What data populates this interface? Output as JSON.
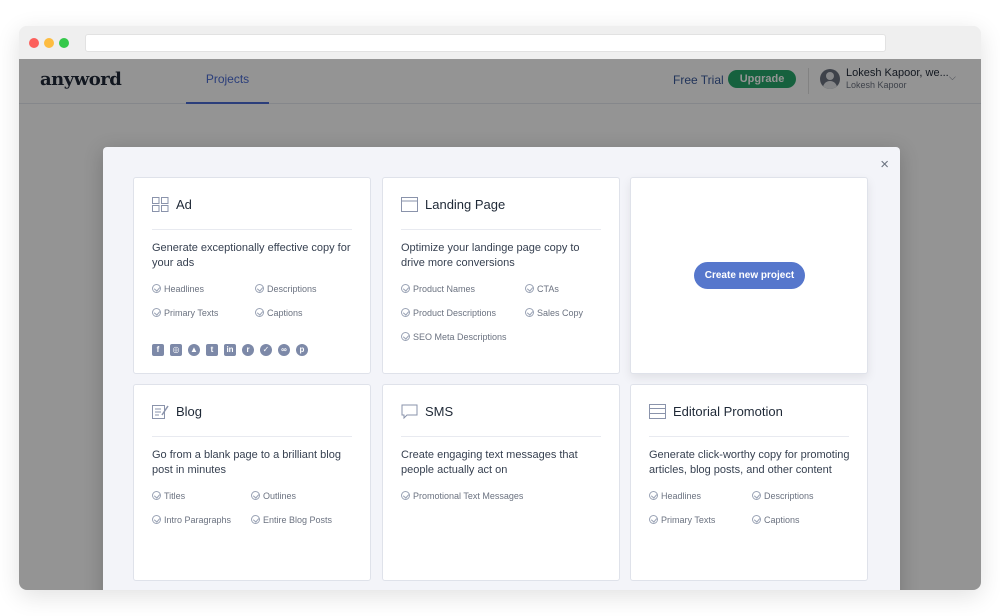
{
  "app": {
    "logo": "anyword",
    "nav_tab": "Projects",
    "free_trial": "Free Trial",
    "upgrade": "Upgrade",
    "user_name": "Lokesh Kapoor, we...",
    "user_sub": "Lokesh Kapoor"
  },
  "modal": {
    "close": "×",
    "create_button": "Create new project",
    "cards": [
      {
        "title": "Ad",
        "icon": "grid-icon",
        "description": "Generate exceptionally effective copy for your ads",
        "features": [
          "Headlines",
          "Descriptions",
          "Primary Texts",
          "Captions"
        ],
        "social_icons": [
          "facebook-icon",
          "instagram-icon",
          "google-ads-icon",
          "twitter-icon",
          "linkedin-icon",
          "reddit-icon",
          "vine-icon",
          "taboola-icon",
          "pinterest-icon"
        ]
      },
      {
        "title": "Landing Page",
        "icon": "browser-window-icon",
        "description": "Optimize your landinge page copy to drive more conversions",
        "features": [
          "Product Names",
          "CTAs",
          "Product Descriptions",
          "Sales Copy",
          "SEO Meta Descriptions"
        ]
      },
      {
        "title": "Blog",
        "icon": "edit-document-icon",
        "description": "Go from a blank page to a brilliant blog post in minutes",
        "features": [
          "Titles",
          "Outlines",
          "Intro Paragraphs",
          "Entire Blog Posts"
        ]
      },
      {
        "title": "SMS",
        "icon": "message-icon",
        "description": "Create engaging text messages that people actually act on",
        "features": [
          "Promotional Text Messages"
        ]
      },
      {
        "title": "Editorial Promotion",
        "icon": "article-icon",
        "description": "Generate click-worthy copy for promoting articles, blog posts, and other content",
        "features": [
          "Headlines",
          "Descriptions",
          "Primary Texts",
          "Captions"
        ]
      }
    ]
  },
  "colors": {
    "accent": "#5677cc",
    "upgrade": "#27a76b",
    "nav_active": "#4a6cd4"
  }
}
